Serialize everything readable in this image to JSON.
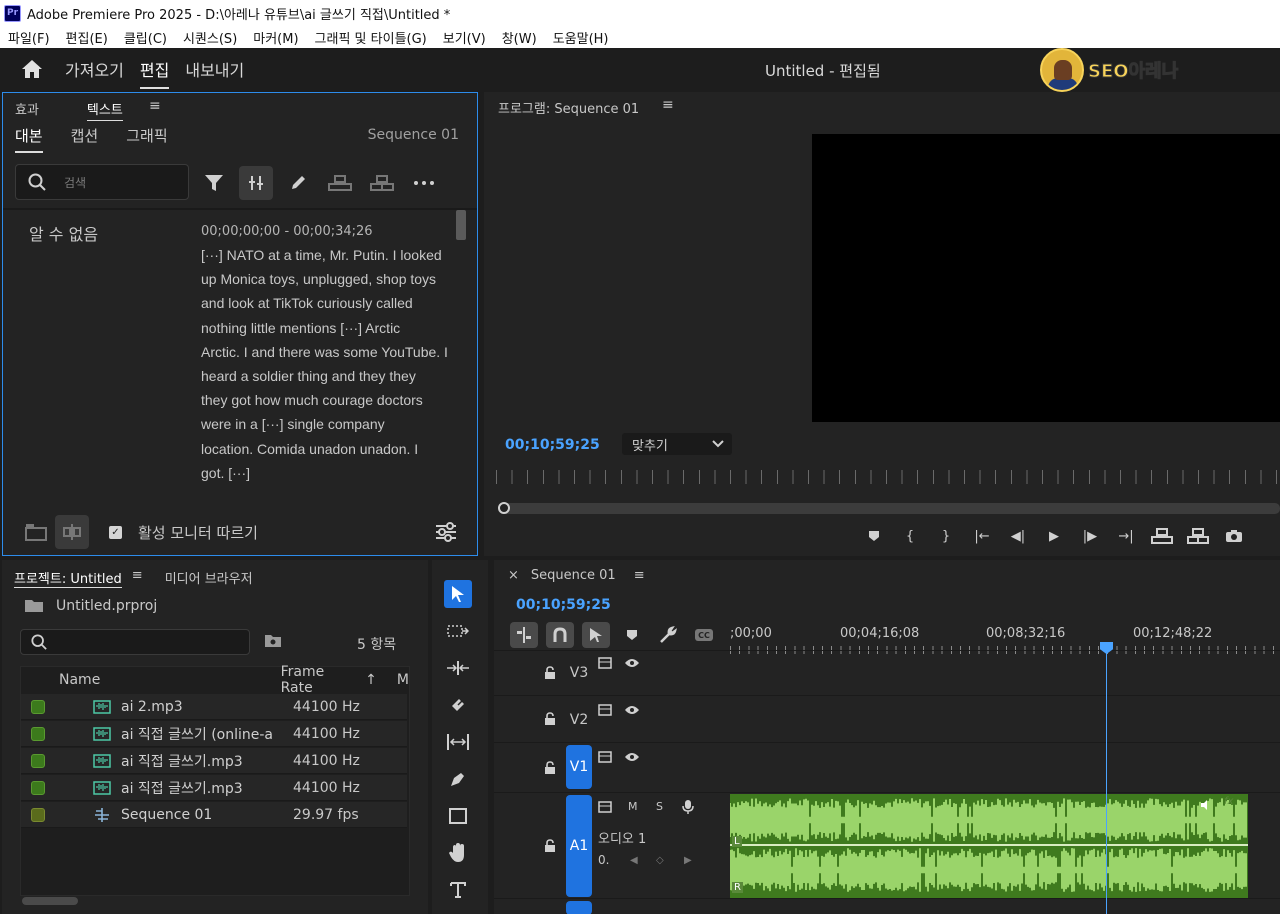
{
  "titlebar": {
    "title": "Adobe Premiere Pro 2025 - D:\\아레나 유튜브\\ai 글쓰기 직접\\Untitled *",
    "logo": "Pr"
  },
  "menu": [
    "파일(F)",
    "편집(E)",
    "클립(C)",
    "시퀀스(S)",
    "마커(M)",
    "그래픽 및 타이틀(G)",
    "보기(V)",
    "창(W)",
    "도움말(H)"
  ],
  "workspace": {
    "tabs": [
      {
        "label": "가져오기"
      },
      {
        "label": "편집"
      },
      {
        "label": "내보내기"
      }
    ],
    "doc_title": "Untitled - 편집됨",
    "brand": "SEO아레나"
  },
  "text_panel": {
    "tab_effects": "효과",
    "tab_text": "텍스트",
    "subtabs": [
      "대본",
      "캡션",
      "그래픽"
    ],
    "sequence": "Sequence 01",
    "search_placeholder": "검색",
    "speaker": "알 수 없음",
    "timecode_range": "00;00;00;00 - 00;00;34;26",
    "transcript_lines": [
      "[···] NATO at a time, Mr. Putin. I looked",
      "up Monica toys, unplugged, shop toys",
      "and look at TikTok curiously called",
      "nothing little mentions [···] Arctic",
      "Arctic. I and there was some YouTube. I",
      "heard a soldier thing and they they",
      "they got how much courage doctors",
      "were in a [···] single company",
      "location. Comida unadon unadon. I",
      "got. [···]"
    ],
    "follow_label": "활성 모니터 따르기",
    "follow_checked": true
  },
  "program": {
    "title": "프로그램: Sequence 01",
    "timecode": "00;10;59;25",
    "fit": "맞추기"
  },
  "project": {
    "tab": "프로젝트: Untitled",
    "tab_media": "미디어 브라우저",
    "file": "Untitled.prproj",
    "count": "5 항목",
    "col_name": "Name",
    "col_rate": "Frame Rate",
    "col_more": "M",
    "items": [
      {
        "name": "ai 2.mp3",
        "rate": "44100 Hz",
        "kind": "audio",
        "swatch": "#3c7a1c"
      },
      {
        "name": "ai 직접 글쓰기 (online-a",
        "rate": "44100 Hz",
        "kind": "audio",
        "swatch": "#3c7a1c"
      },
      {
        "name": "ai 직접 글쓰기.mp3",
        "rate": "44100 Hz",
        "kind": "audio",
        "swatch": "#3c7a1c"
      },
      {
        "name": "ai 직접 글쓰기.mp3",
        "rate": "44100 Hz",
        "kind": "audio",
        "swatch": "#3c7a1c"
      },
      {
        "name": "Sequence 01",
        "rate": "29.97 fps",
        "kind": "sequence",
        "swatch": "#5a6b1c"
      }
    ]
  },
  "timeline": {
    "tab": "Sequence 01",
    "timecode": "00;10;59;25",
    "ruler": [
      ";00;00",
      "00;04;16;08",
      "00;08;32;16",
      "00;12;48;22"
    ],
    "tracks": [
      {
        "name": "V3",
        "active": false
      },
      {
        "name": "V2",
        "active": false
      },
      {
        "name": "V1",
        "active": true
      },
      {
        "name": "A1",
        "active": true,
        "label": "오디오 1",
        "m": "M",
        "s": "S"
      }
    ],
    "clip_channels": [
      "L",
      "R"
    ],
    "playhead_fraction": 0.73
  },
  "colors": {
    "accent": "#2d8ceb",
    "timecode": "#4aa3ff",
    "audio_clip": "#87c35a",
    "track_on": "#1f73e0"
  }
}
